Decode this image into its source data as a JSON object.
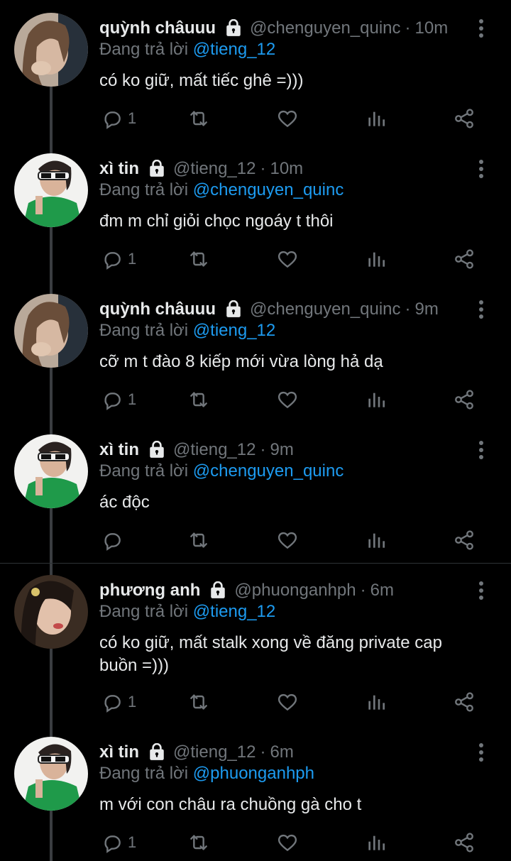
{
  "reply_prefix": "Đang trả lời",
  "tweets": [
    {
      "name": "quỳnh châuuu",
      "handle": "@chenguyen_quinc",
      "dot": "·",
      "time": "10m",
      "reply_to": "@tieng_12",
      "text": "có ko giữ, mất tiếc ghê =)))",
      "reply_count": "1",
      "avatar": "quynh"
    },
    {
      "name": "xì tin",
      "handle": "@tieng_12",
      "dot": "·",
      "time": "10m",
      "reply_to": "@chenguyen_quinc",
      "text": "đm m chỉ giỏi chọc ngoáy t thôi",
      "reply_count": "1",
      "avatar": "xitin"
    },
    {
      "name": "quỳnh châuuu",
      "handle": "@chenguyen_quinc",
      "dot": "·",
      "time": "9m",
      "reply_to": "@tieng_12",
      "text": "cỡ m t đào 8 kiếp mới vừa lòng hả dạ",
      "reply_count": "1",
      "avatar": "quynh"
    },
    {
      "name": "xì tin",
      "handle": "@tieng_12",
      "dot": "·",
      "time": "9m",
      "reply_to": "@chenguyen_quinc",
      "text": "ác độc",
      "reply_count": "",
      "avatar": "xitin"
    },
    {
      "name": "phương anh",
      "handle": "@phuonganhph",
      "dot": "·",
      "time": "6m",
      "reply_to": "@tieng_12",
      "text": "có ko giữ, mất stalk xong về đăng private cap buồn =)))",
      "reply_count": "1",
      "avatar": "phuong"
    },
    {
      "name": "xì tin",
      "handle": "@tieng_12",
      "dot": "·",
      "time": "6m",
      "reply_to": "@phuonganhph",
      "text": "m với con châu ra chuồng gà cho t",
      "reply_count": "1",
      "avatar": "xitin"
    }
  ],
  "icons": {
    "lock": "lock-icon",
    "reply": "reply-icon",
    "retweet": "retweet-icon",
    "like": "heart-icon",
    "views": "views-icon",
    "share": "share-icon",
    "more": "more-vertical-icon"
  },
  "colors": {
    "background": "#000000",
    "text": "#e7e9ea",
    "muted": "#71767b",
    "link": "#1d9bf0",
    "thread": "#3a3d41"
  }
}
